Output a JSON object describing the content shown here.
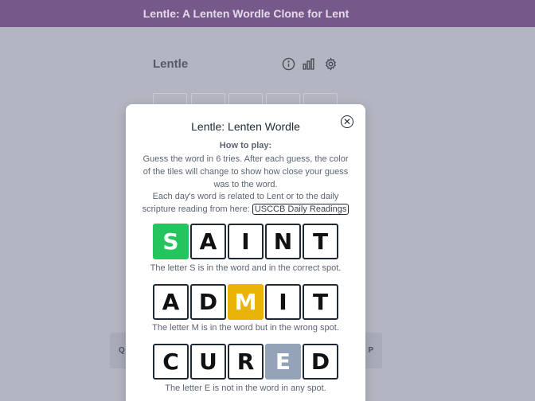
{
  "banner": {
    "title": "Lentle: A Lenten Wordle Clone for Lent"
  },
  "header": {
    "title": "Lentle",
    "icons": [
      "info-icon",
      "chart-icon",
      "settings-icon"
    ]
  },
  "background": {
    "keyboard_left": "Q",
    "keyboard_right": "P"
  },
  "modal": {
    "title": "Lentle: Lenten Wordle",
    "close_symbol": "✕",
    "how_heading": "How to play:",
    "para1": "Guess the word in 6 tries. After each guess, the color of the tiles will change to show how close your guess was to the word.",
    "para2_prefix": "Each day's word is related to Lent or to the daily scripture reading from here:",
    "link_text": "USCCB Daily Readings",
    "examples": [
      {
        "letters": [
          "S",
          "A",
          "I",
          "N",
          "T"
        ],
        "highlight_index": 0,
        "status": "correct",
        "caption": "The letter S is in the word and in the correct spot."
      },
      {
        "letters": [
          "A",
          "D",
          "M",
          "I",
          "T"
        ],
        "highlight_index": 2,
        "status": "present",
        "caption": "The letter M is in the word but in the wrong spot."
      },
      {
        "letters": [
          "C",
          "U",
          "R",
          "E",
          "D"
        ],
        "highlight_index": 3,
        "status": "absent",
        "caption": "The letter E is not in the word in any spot."
      }
    ]
  },
  "colors": {
    "correct": "#22c55e",
    "present": "#eab308",
    "absent": "#94a3b8",
    "banner": "#76598a"
  }
}
